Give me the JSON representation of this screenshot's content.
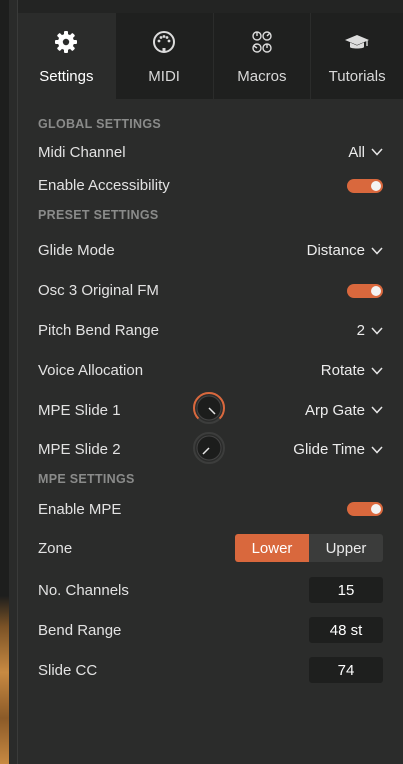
{
  "tabs": [
    {
      "label": "Settings",
      "icon": "gear-icon",
      "active": true
    },
    {
      "label": "MIDI",
      "icon": "midi-connector-icon",
      "active": false
    },
    {
      "label": "Macros",
      "icon": "macro-knobs-icon",
      "active": false
    },
    {
      "label": "Tutorials",
      "icon": "graduation-cap-icon",
      "active": false
    }
  ],
  "global": {
    "header": "GLOBAL SETTINGS",
    "midi_channel_label": "Midi Channel",
    "midi_channel_value": "All",
    "accessibility_label": "Enable Accessibility",
    "accessibility_on": true
  },
  "preset": {
    "header": "PRESET SETTINGS",
    "glide_mode_label": "Glide Mode",
    "glide_mode_value": "Distance",
    "osc3_fm_label": "Osc 3 Original FM",
    "osc3_fm_on": true,
    "pitch_bend_label": "Pitch Bend Range",
    "pitch_bend_value": "2",
    "voice_alloc_label": "Voice Allocation",
    "voice_alloc_value": "Rotate",
    "mpe_slide1_label": "MPE Slide 1",
    "mpe_slide1_value": "Arp Gate",
    "mpe_slide2_label": "MPE Slide 2",
    "mpe_slide2_value": "Glide Time"
  },
  "mpe": {
    "header": "MPE SETTINGS",
    "enable_label": "Enable MPE",
    "enable_on": true,
    "zone_label": "Zone",
    "zone_options": [
      "Lower",
      "Upper"
    ],
    "zone_selected": "Lower",
    "channels_label": "No. Channels",
    "channels_value": "15",
    "bend_range_label": "Bend Range",
    "bend_range_value": "48 st",
    "slide_cc_label": "Slide CC",
    "slide_cc_value": "74"
  },
  "colors": {
    "accent": "#d9683d",
    "panel_bg": "#2b2c2b",
    "tab_bg": "#1f201f"
  }
}
